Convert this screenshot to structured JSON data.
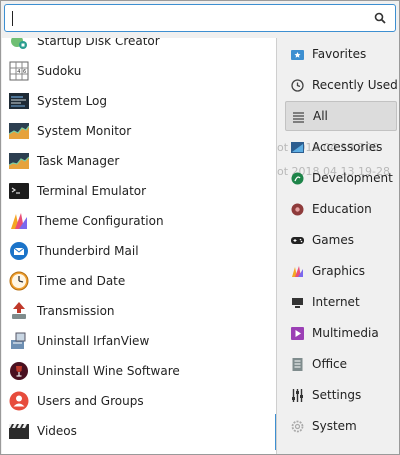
{
  "search": {
    "value": "",
    "placeholder": "",
    "icon": "search-icon"
  },
  "apps": [
    {
      "label": "Startup Disk Creator",
      "icon": "disk-creator-icon"
    },
    {
      "label": "Sudoku",
      "icon": "sudoku-icon"
    },
    {
      "label": "System Log",
      "icon": "system-log-icon"
    },
    {
      "label": "System Monitor",
      "icon": "system-monitor-icon"
    },
    {
      "label": "Task Manager",
      "icon": "task-manager-icon"
    },
    {
      "label": "Terminal Emulator",
      "icon": "terminal-icon"
    },
    {
      "label": "Theme Configuration",
      "icon": "theme-icon"
    },
    {
      "label": "Thunderbird Mail",
      "icon": "thunderbird-icon"
    },
    {
      "label": "Time and Date",
      "icon": "clock-icon"
    },
    {
      "label": "Transmission",
      "icon": "transmission-icon"
    },
    {
      "label": "Uninstall IrfanView",
      "icon": "uninstall-irfanview-icon"
    },
    {
      "label": "Uninstall Wine Software",
      "icon": "wine-icon"
    },
    {
      "label": "Users and Groups",
      "icon": "users-icon"
    },
    {
      "label": "Videos",
      "icon": "videos-icon"
    }
  ],
  "categories": [
    {
      "label": "Favorites",
      "icon": "favorites-icon"
    },
    {
      "label": "Recently Used",
      "icon": "recently-used-icon"
    },
    {
      "label": "All",
      "icon": "all-list-icon",
      "selected": true
    },
    {
      "label": "Accessories",
      "icon": "accessories-icon"
    },
    {
      "label": "Development",
      "icon": "development-icon"
    },
    {
      "label": "Education",
      "icon": "education-icon"
    },
    {
      "label": "Games",
      "icon": "games-icon"
    },
    {
      "label": "Graphics",
      "icon": "graphics-icon"
    },
    {
      "label": "Internet",
      "icon": "internet-icon"
    },
    {
      "label": "Multimedia",
      "icon": "multimedia-icon"
    },
    {
      "label": "Office",
      "icon": "office-icon"
    },
    {
      "label": "Settings",
      "icon": "settings-icon"
    },
    {
      "label": "System",
      "icon": "system-icon"
    }
  ],
  "background_text": [
    "ot 2018 04 13 300",
    "ot 2018 04 13 19-28"
  ],
  "colors": {
    "accent": "#3d8fd1",
    "selected_bg": "#dcdcdc",
    "panel_bg": "#f0f0f0"
  }
}
